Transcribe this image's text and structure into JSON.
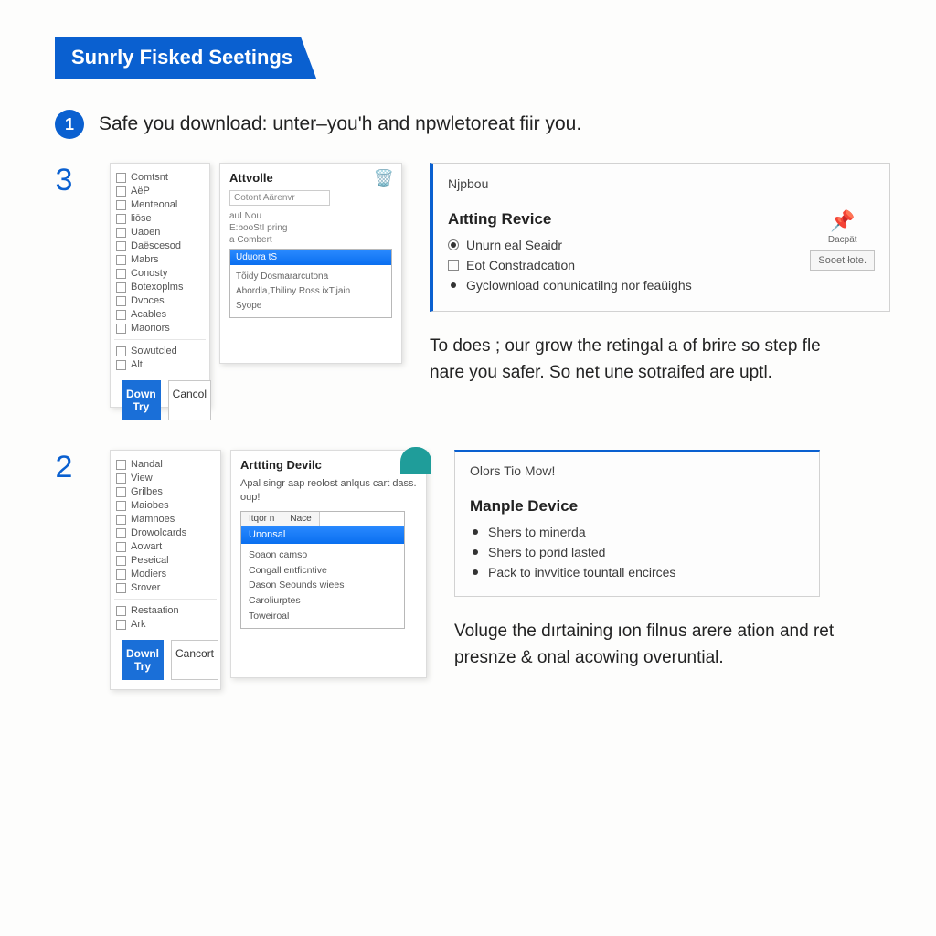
{
  "banner": "Sunrly Fisked Seetings",
  "step1": {
    "num": "1",
    "text": "Safe you download: unter–you'h and npwletoreat fiir you."
  },
  "step3": {
    "num": "3",
    "sidebar_items": [
      "Comtsnt",
      "AëP",
      "Menteonal",
      "liōse",
      "Uaoen",
      "Daëscesod",
      "Mabrs",
      "Conosty",
      "Botexoplms",
      "Dvoces",
      "Acables",
      "Maoriors"
    ],
    "sidebar_extra": "Sowutcled",
    "btn_primary": "Down Try",
    "btn_secondary": "Cancol",
    "main_title": "Attvolle",
    "main_input": "Cotont Aärenvr",
    "main_subs": [
      "auLNou",
      "E:booStI pring",
      "a Combert"
    ],
    "sel_header": "Uduora tS",
    "sel_body": [
      "Tõidy Dosmararcutona",
      "Abordla,Thiliny Ross ixTijain",
      "Syope"
    ],
    "callout_tab": "Njpbou",
    "callout_title": "Aıtting Revice",
    "callout_items": [
      {
        "kind": "radio",
        "selected": true,
        "label": "Unurn eal Seaidr"
      },
      {
        "kind": "check",
        "selected": false,
        "label": "Eot Constradcation"
      },
      {
        "kind": "bullet",
        "selected": false,
        "label": "Gyclownload conunicatilng nor feaüighs"
      }
    ],
    "side_label": "Dacpät",
    "side_btn": "Sooet łote.",
    "para": "To does ; our grow the retingal a of brire so step fle nare you safer. So net une sotraifed are uptl."
  },
  "step2": {
    "num": "2",
    "sidebar_items": [
      "Nandal",
      "View",
      "Grilbes",
      "Maiobes",
      "Mamnoes",
      "Drowolcards",
      "Aowart",
      "Peseical",
      "Modiers",
      "Srover"
    ],
    "sidebar_extra": [
      "Restaation",
      "Ark"
    ],
    "btn_primary": "Downl Try",
    "btn_secondary": "Cancort",
    "main_title": "Arttting Devilc",
    "main_sub": "Apal singr aap reolost anlqus cart dass. oup!",
    "sel_tabs": [
      "Itqor n",
      "Nace"
    ],
    "sel_hi": "Unonsal",
    "sel_body": [
      "Soaon camso",
      "Congall entficntive",
      "Dason Seounds wiees",
      "Caroliurptes",
      "Toweiroal"
    ],
    "callout_tab": "Olors Tio Mow!",
    "callout_title": "Manple Device",
    "callout_items": [
      "Shers to minerda",
      "Shers to porid lasted",
      "Pack to invvitice tountall encirces"
    ],
    "para": "Voluge the dırtaining ıon filnus arere ation and ret presnze & onal acowing overuntial."
  }
}
